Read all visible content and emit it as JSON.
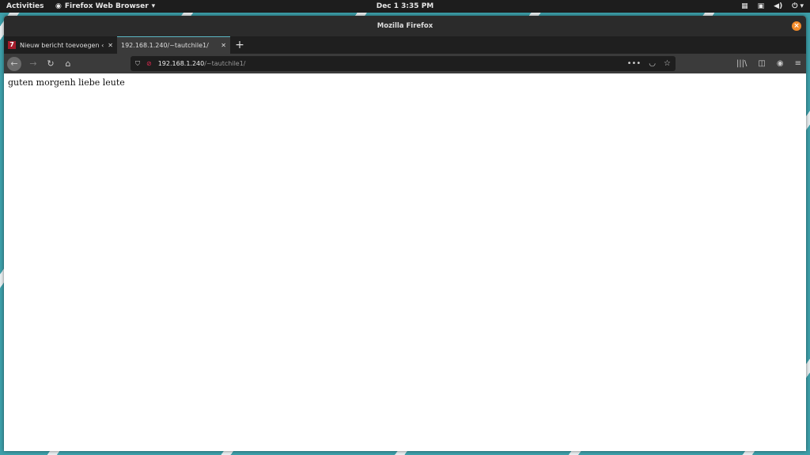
{
  "topbar": {
    "activities": "Activities",
    "app": "Firefox Web Browser",
    "clock": "Dec 1   3:35 PM"
  },
  "window": {
    "title": "Mozilla Firefox"
  },
  "tabs": [
    {
      "label": "Nieuw bericht toevoegen ‹",
      "favicon": "7"
    },
    {
      "label": "192.168.1.240/~tautchile1/"
    }
  ],
  "url": {
    "host": "192.168.1.240",
    "path": "/~tautchile1/"
  },
  "page": {
    "text": "guten morgenh liebe leute"
  }
}
